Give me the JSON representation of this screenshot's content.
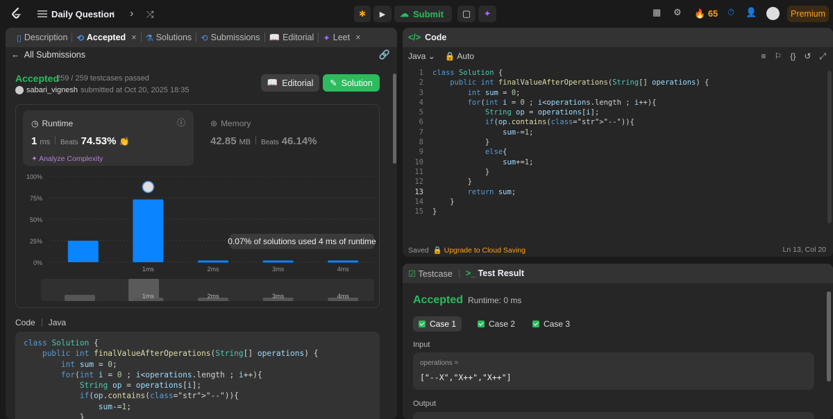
{
  "topbar": {
    "title": "Daily Question",
    "submit_label": "Submit",
    "streak_count": "65",
    "premium_label": "Premium"
  },
  "left": {
    "tabs": [
      {
        "label": "Description"
      },
      {
        "label": "Accepted"
      },
      {
        "label": "Solutions"
      },
      {
        "label": "Submissions"
      },
      {
        "label": "Editorial"
      },
      {
        "label": "Leet"
      }
    ],
    "back_label": "All Submissions",
    "status": "Accepted",
    "testcases": "259 / 259 testcases passed",
    "username": "sabari_vignesh",
    "submitted_text": "submitted at Oct 20, 2025 18:35",
    "editorial_button": "Editorial",
    "solution_button": "Solution",
    "runtime": {
      "title": "Runtime",
      "value": "1",
      "unit": "ms",
      "beats_label": "Beats",
      "beats_value": "74.53%",
      "analyze_label": "Analyze Complexity"
    },
    "memory": {
      "title": "Memory",
      "value": "42.85",
      "unit": "MB",
      "beats_label": "Beats",
      "beats_value": "46.14%"
    },
    "tooltip": "0.07% of solutions used 4 ms of runtime",
    "code_header": {
      "label": "Code",
      "lang": "Java"
    },
    "code_lines": [
      "class Solution {",
      "    public int finalValueAfterOperations(String[] operations) {",
      "        int sum = 0;",
      "        for(int i = 0 ; i<operations.length ; i++){",
      "            String op = operations[i];",
      "            if(op.contains(\"--\")){",
      "                sum-=1;",
      "            }"
    ]
  },
  "chart_data": {
    "type": "bar",
    "categories": [
      "",
      "1ms",
      "2ms",
      "3ms",
      "4ms"
    ],
    "values": [
      25,
      73,
      2,
      2,
      2
    ],
    "ylim": [
      0,
      100
    ],
    "yticks": [
      "0%",
      "25%",
      "50%",
      "75%",
      "100%"
    ],
    "highlight_category": "1ms",
    "colors": {
      "bar": "#0a84ff",
      "grid": "#3a3a3a"
    },
    "minimap_labels": [
      "1ms",
      "2ms",
      "3ms",
      "4ms"
    ]
  },
  "editor": {
    "title": "Code",
    "language": "Java",
    "mode": "Auto",
    "line_numbers": [
      "1",
      "2",
      "3",
      "4",
      "5",
      "6",
      "7",
      "8",
      "9",
      "10",
      "11",
      "12",
      "13",
      "14",
      "15"
    ],
    "saved_label": "Saved",
    "upgrade_label": "Upgrade to Cloud Saving",
    "cursor_position": "Ln 13, Col 20",
    "code_lines": [
      "class Solution {",
      "    public int finalValueAfterOperations(String[] operations) {",
      "        int sum = 0;",
      "        for(int i = 0 ; i<operations.length ; i++){",
      "            String op = operations[i];",
      "            if(op.contains(\"--\")){",
      "                sum-=1;",
      "            }",
      "            else{",
      "                sum+=1;",
      "            }",
      "        }",
      "        return sum;",
      "    }",
      "}"
    ]
  },
  "result": {
    "testcase_tab": "Testcase",
    "result_tab": "Test Result",
    "status": "Accepted",
    "runtime": "Runtime: 0 ms",
    "cases": [
      "Case 1",
      "Case 2",
      "Case 3"
    ],
    "input_label": "Input",
    "input_var": "operations =",
    "input_value": "[\"--X\",\"X++\",\"X++\"]",
    "output_label": "Output"
  }
}
